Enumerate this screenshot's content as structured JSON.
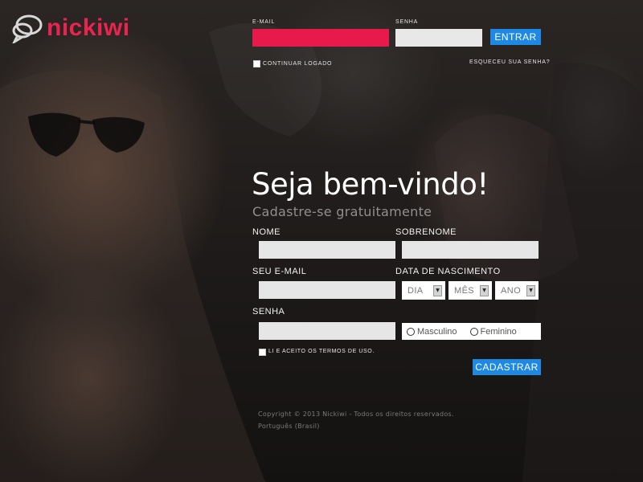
{
  "brand": {
    "name": "nickiwi",
    "accent": "#e8244f",
    "button_color": "#1e88e5"
  },
  "login": {
    "email_label": "E-MAIL",
    "email_value": "",
    "password_label": "SENHA",
    "password_value": "",
    "submit_label": "ENTRAR",
    "remember_label": "CONTINUAR LOGADO",
    "forgot_label": "ESQUECEU SUA SENHA?"
  },
  "signup": {
    "title": "Seja bem-vindo!",
    "subtitle": "Cadastre-se gratuitamente",
    "first_name_label": "NOME",
    "last_name_label": "SOBRENOME",
    "email_label": "SEU E-MAIL",
    "birthdate_label": "DATA DE NASCIMENTO",
    "day_value": "DIA",
    "month_value": "MÊS",
    "year_value": "ANO",
    "password_label": "SENHA",
    "gender_male": "Masculino",
    "gender_female": "Feminino",
    "terms_label": "LI E ACEITO OS TERMOS DE USO.",
    "submit_label": "CADASTRAR"
  },
  "footer": {
    "copyright": "Copyright © 2013 Nickiwi - Todos os direitos reservados.",
    "language": "Português (Brasil)"
  },
  "icons": {
    "logo": "speech-bubble-logo-icon",
    "select_arrow": "chevron-down-icon"
  }
}
